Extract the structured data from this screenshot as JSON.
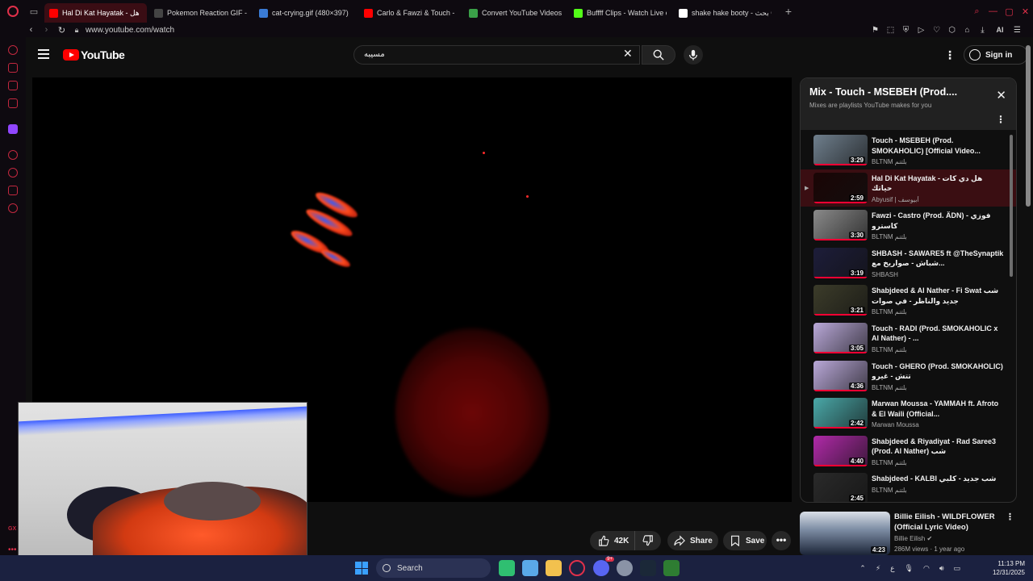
{
  "browser": {
    "tabs": [
      {
        "title": "Hal Di Kat Hayatak - هل",
        "active": true,
        "favicon": "youtube-icon"
      },
      {
        "title": "Pokemon Reaction GIF - P",
        "active": false,
        "favicon": "page-icon"
      },
      {
        "title": "cat-crying.gif (480×397)",
        "active": false,
        "favicon": "gif-icon"
      },
      {
        "title": "Carlo & Fawzi & Touch - Y",
        "active": false,
        "favicon": "youtube-icon"
      },
      {
        "title": "Convert YouTube Videos t",
        "active": false,
        "favicon": "download-icon"
      },
      {
        "title": "Buffff Clips - Watch Live o",
        "active": false,
        "favicon": "kick-icon"
      },
      {
        "title": "shake hake booty - بحث Go",
        "active": false,
        "favicon": "google-icon"
      }
    ],
    "url": "www.youtube.com/watch",
    "ai_label": "AI"
  },
  "youtube": {
    "logo_text": "YouTube",
    "search_query": "مسيبه",
    "signin_label": "Sign in",
    "actions": {
      "like_count": "42K",
      "share_label": "Share",
      "save_label": "Save"
    },
    "playlist": {
      "title": "Mix - Touch - MSEBEH (Prod....",
      "subtitle": "Mixes are playlists YouTube makes for you",
      "items": [
        {
          "title": "Touch - MSEBEH (Prod. SMOKAHOLIC) [Official Video...",
          "channel": "BLTNM بلتنم",
          "duration": "3:29",
          "current": false,
          "index": "",
          "thumb": "#6f7f8d"
        },
        {
          "title": "Hal Di Kat Hayatak - هل دي كات حياتك",
          "channel": "Abyusif | أبيوسف",
          "duration": "2:59",
          "current": true,
          "index": "▶",
          "thumb": "#1a0505"
        },
        {
          "title": "Fawzi - Castro (Prod. ÄDN) فوزي - كاسترو",
          "channel": "BLTNM بلتنم",
          "duration": "3:30",
          "current": false,
          "index": "",
          "thumb": "#8a8a8a"
        },
        {
          "title": "SHBASH - SAWARE5 ft @TheSynaptik شباش - صواريخ مع...",
          "channel": "SHBASH",
          "duration": "3:19",
          "current": false,
          "index": "",
          "thumb": "#1d1d3a"
        },
        {
          "title": "Shabjdeed & Al Nather - Fi Swat شب جديد والناظر - في صوات",
          "channel": "BLTNM بلتنم",
          "duration": "3:21",
          "current": false,
          "index": "",
          "thumb": "#3c3c2a"
        },
        {
          "title": "Touch - RADI (Prod. SMOKAHOLIC x Al Nather) - ...",
          "channel": "BLTNM بلتنم",
          "duration": "3:05",
          "current": false,
          "index": "",
          "thumb": "#b9a8d8"
        },
        {
          "title": "Touch - GHERO (Prod. SMOKAHOLIC) تتش - غيرو",
          "channel": "BLTNM بلتنم",
          "duration": "4:36",
          "current": false,
          "index": "",
          "thumb": "#b9a8d8"
        },
        {
          "title": "Marwan Moussa - YAMMAH ft. Afroto & El Waili (Official...",
          "channel": "Marwan Moussa",
          "duration": "2:42",
          "current": false,
          "index": "",
          "thumb": "#4aa8a8"
        },
        {
          "title": "Shabjdeed & Riyadiyat - Rad Saree3 (Prod. Al Nather) شب",
          "channel": "BLTNM بلتنم",
          "duration": "4:40",
          "current": false,
          "index": "",
          "thumb": "#b02aa8"
        },
        {
          "title": "Shabjdeed - KALBI شب جديد - كلبي",
          "channel": "BLTNM بلتنم",
          "duration": "2:45",
          "current": false,
          "index": "",
          "thumb": "#2a2a2a"
        }
      ]
    },
    "recommended": {
      "title": "Billie Eilish - WILDFLOWER (Official Lyric Video)",
      "channel": "Billie Eilish",
      "meta": "286M views · 1 year ago",
      "duration": "4:23"
    }
  },
  "taskbar": {
    "search_label": "Search",
    "tray_lang": "ع",
    "time": "11:13 PM",
    "date": "12/31/2025",
    "discord_badge": "9+"
  },
  "colors": {
    "accent_red": "#ff0000",
    "opera_red": "#e0304a",
    "current_item_bg": "#3a0e12",
    "taskbar_bg": "#1b2140"
  }
}
